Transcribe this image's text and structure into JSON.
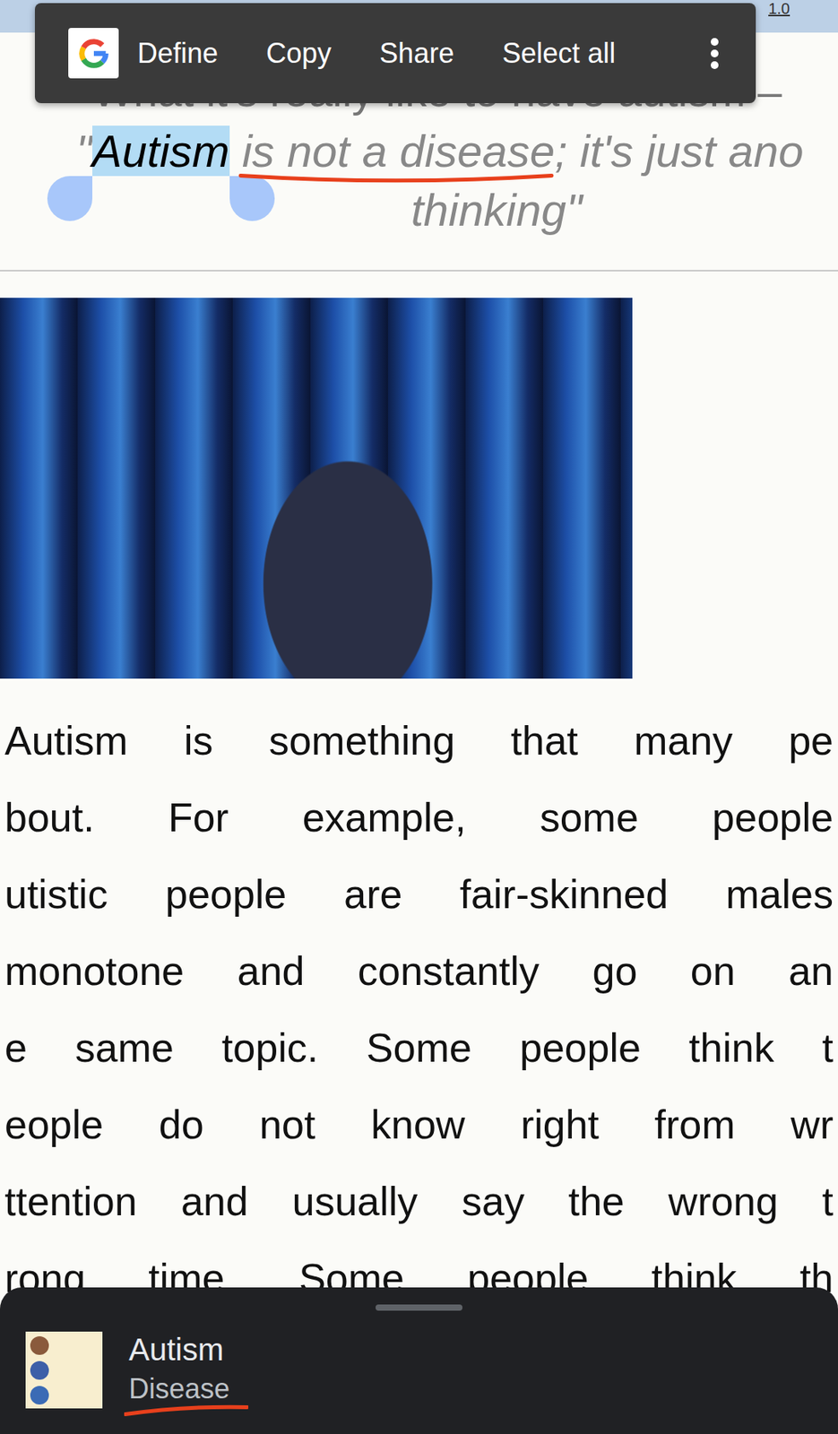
{
  "top_bar": {
    "link": "1.0"
  },
  "selection_toolbar": {
    "items": [
      "Define",
      "Copy",
      "Share",
      "Select all"
    ]
  },
  "article": {
    "heading": "– What it's really like to have autism –",
    "quote_lines": [
      [
        {
          "text": "\"",
          "selected": false,
          "underlined": false
        },
        {
          "text": "Autism",
          "selected": true,
          "underlined": false
        },
        {
          "text": " ",
          "selected": false,
          "underlined": false
        },
        {
          "text": "is not a disease",
          "selected": false,
          "underlined": true
        },
        {
          "text": "; it's just ano",
          "selected": false,
          "underlined": false
        }
      ],
      [
        {
          "text": "thinking\"",
          "selected": false,
          "underlined": false
        }
      ]
    ],
    "body_lines": [
      "Autism is something that many pe",
      "bout. For example, some people",
      "utistic people are fair-skinned males",
      "monotone and constantly go on an",
      "e same topic. Some people think t",
      "eople do not know right from wr",
      "ttention and usually say the wrong t",
      "rong time. Some people think th"
    ]
  },
  "bottom_sheet": {
    "title": "Autism",
    "subtitle": {
      "text": "Disease",
      "underlined": true
    }
  }
}
